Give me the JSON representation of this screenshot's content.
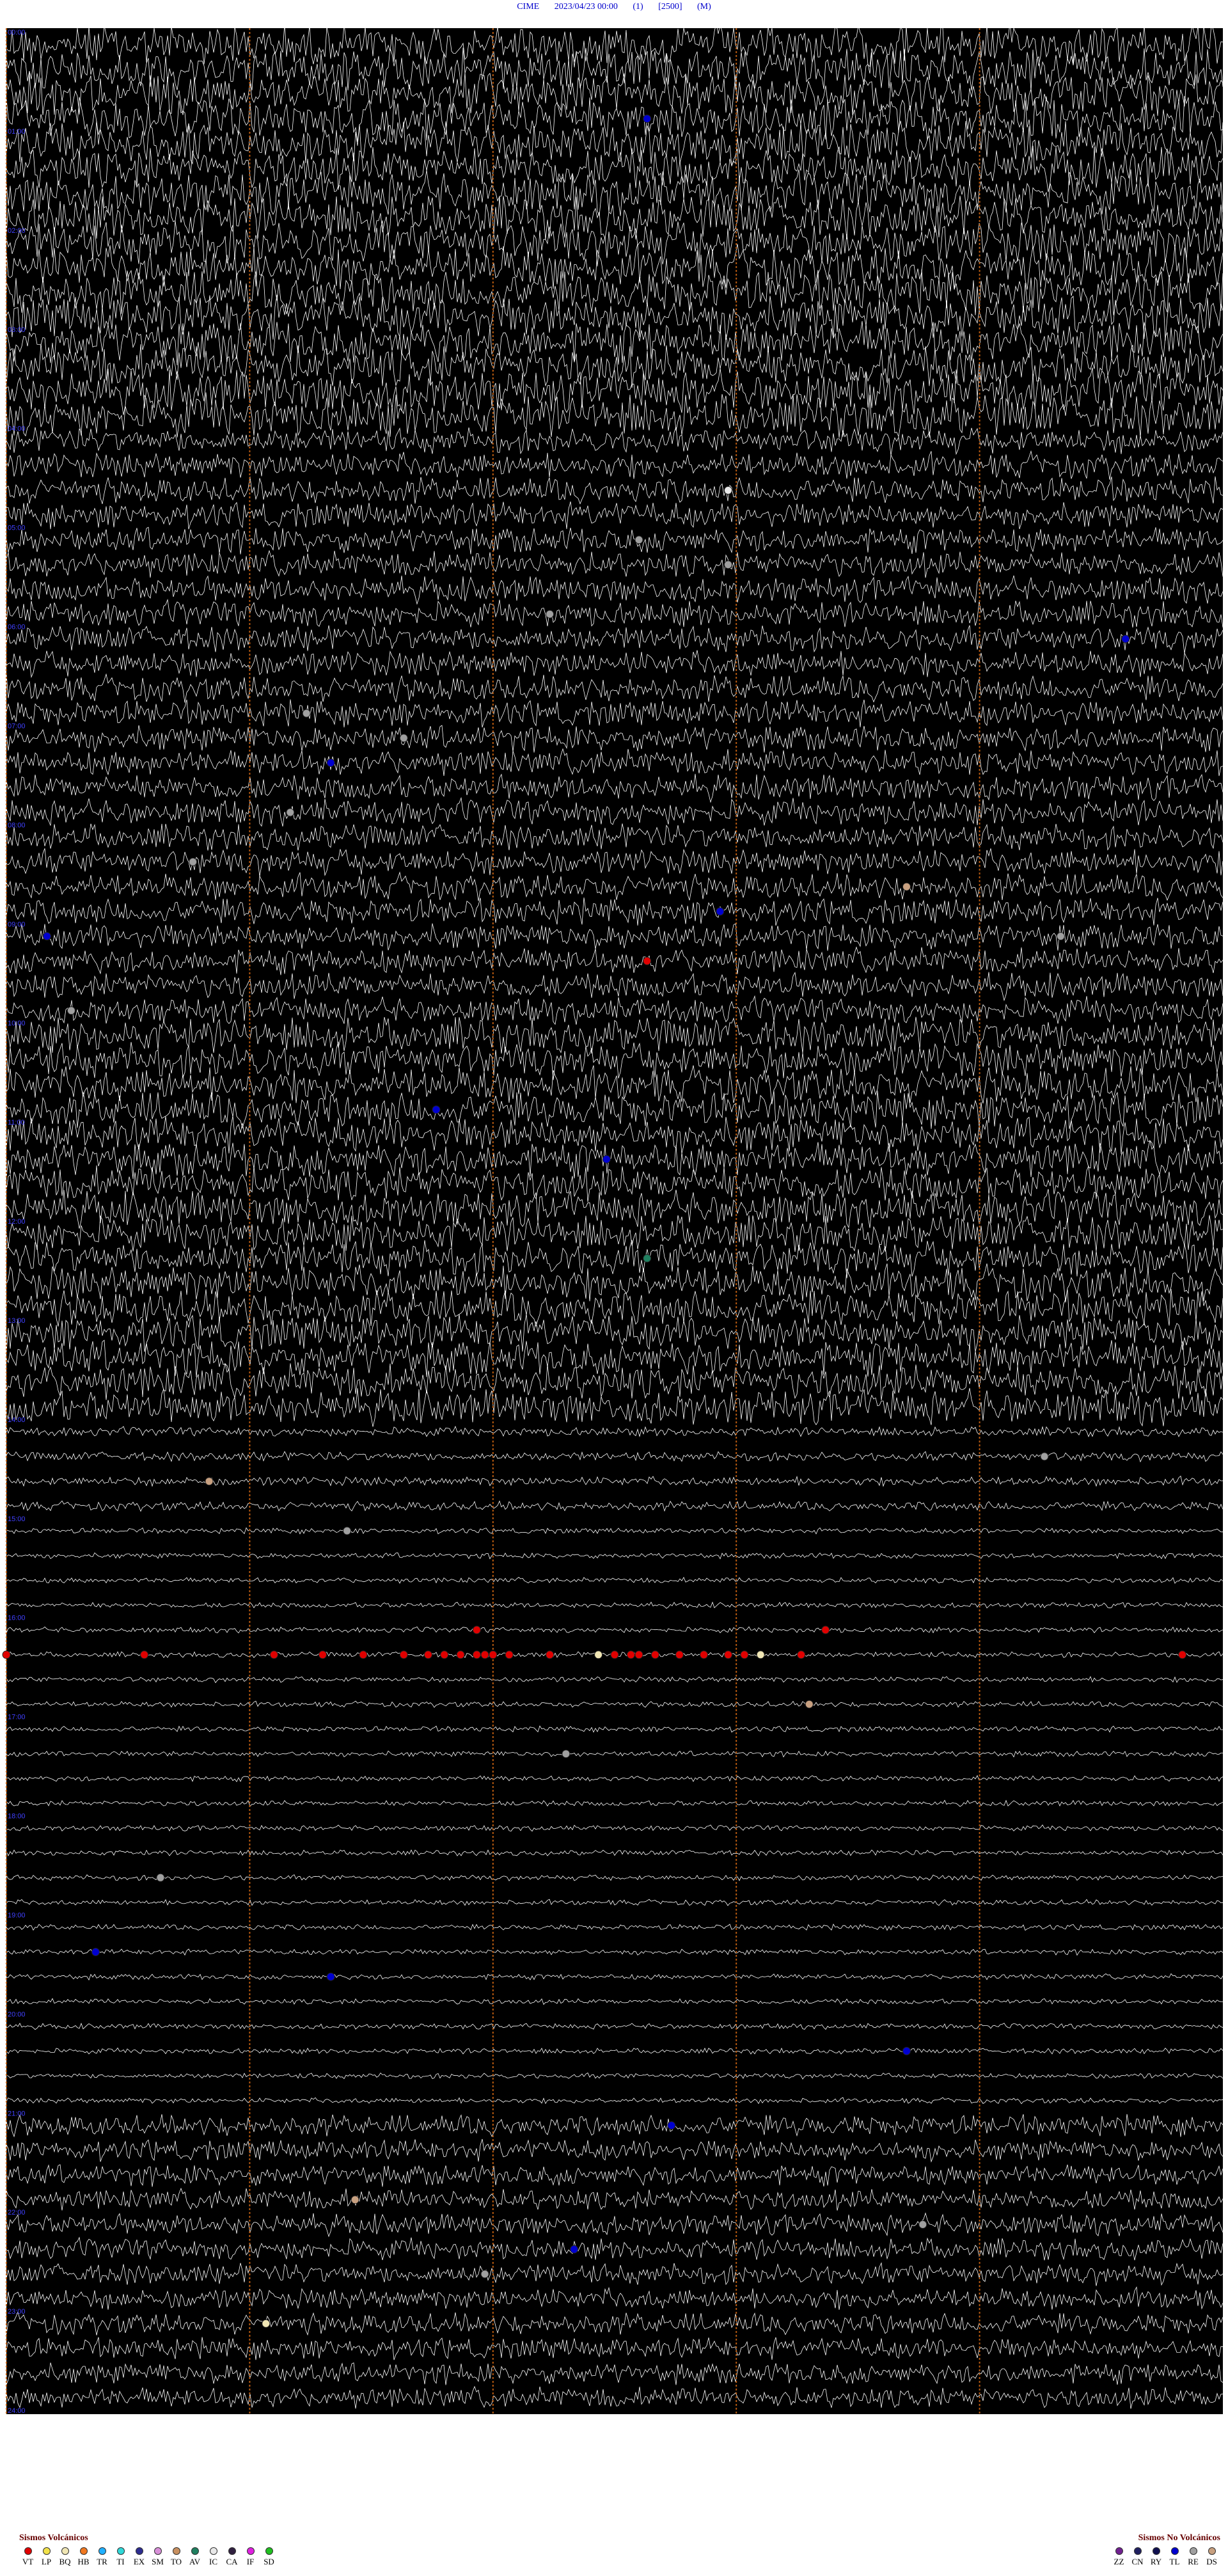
{
  "header": {
    "station": "CIME",
    "datetime": "2023/04/23 00:00",
    "component": "(1)",
    "scale": "[2500]",
    "mode": "(M)"
  },
  "chart_data": {
    "type": "scatter",
    "title": "CIME 2023/04/23 00:00 (1) [2500] (M)",
    "time_labels": [
      "00:00",
      "01:00",
      "02:00",
      "03:00",
      "04:00",
      "05:00",
      "06:00",
      "07:00",
      "08:00",
      "09:00",
      "10:00",
      "11:00",
      "12:00",
      "13:00",
      "14:00",
      "15:00",
      "16:00",
      "17:00",
      "18:00",
      "19:00",
      "20:00",
      "21:00",
      "22:00",
      "23:00",
      "24:00"
    ],
    "trace_rows": 96,
    "minutes_per_row": 15,
    "x_range_minutes": [
      0,
      15
    ],
    "minute_markers": [
      0,
      3,
      6,
      9,
      12
    ],
    "colors": {
      "VT": "#e00000",
      "LP": "#f2e24a",
      "BQ": "#f0e6b4",
      "HB": "#f07820",
      "TR": "#20b0ff",
      "TI": "#30d8d8",
      "EX": "#2c2c90",
      "SM": "#d890d8",
      "TO": "#c89060",
      "AV": "#208060",
      "IC": "#e8e8e8",
      "CA": "#302040",
      "IF": "#e020e0",
      "SD": "#20c020",
      "ZZ": "#702090",
      "CN": "#202060",
      "RY": "#101050",
      "TL": "#0000d0",
      "RE": "#a0a0a0",
      "DS": "#c8a080"
    },
    "events": [
      {
        "row": 3,
        "minute": 7.9,
        "type": "TL"
      },
      {
        "row": 18,
        "minute": 8.9,
        "type": "IC"
      },
      {
        "row": 20,
        "minute": 7.8,
        "type": "RE"
      },
      {
        "row": 21,
        "minute": 8.9,
        "type": "RE"
      },
      {
        "row": 23,
        "minute": 6.7,
        "type": "RE"
      },
      {
        "row": 24,
        "minute": 13.8,
        "type": "TL"
      },
      {
        "row": 27,
        "minute": 3.7,
        "type": "RE"
      },
      {
        "row": 28,
        "minute": 4.9,
        "type": "RE"
      },
      {
        "row": 29,
        "minute": 4.0,
        "type": "TL"
      },
      {
        "row": 31,
        "minute": 3.5,
        "type": "RE"
      },
      {
        "row": 33,
        "minute": 2.3,
        "type": "RE"
      },
      {
        "row": 34,
        "minute": 11.1,
        "type": "DS"
      },
      {
        "row": 35,
        "minute": 8.8,
        "type": "TL"
      },
      {
        "row": 36,
        "minute": 13.0,
        "type": "RE"
      },
      {
        "row": 36,
        "minute": 0.5,
        "type": "TL"
      },
      {
        "row": 37,
        "minute": 7.9,
        "type": "VT"
      },
      {
        "row": 39,
        "minute": 0.8,
        "type": "RE"
      },
      {
        "row": 43,
        "minute": 5.3,
        "type": "TL"
      },
      {
        "row": 45,
        "minute": 7.4,
        "type": "TL"
      },
      {
        "row": 49,
        "minute": 7.9,
        "type": "AV"
      },
      {
        "row": 57,
        "minute": 12.8,
        "type": "RE"
      },
      {
        "row": 58,
        "minute": 2.5,
        "type": "DS"
      },
      {
        "row": 60,
        "minute": 4.2,
        "type": "RE"
      },
      {
        "row": 65,
        "minute": 0.0,
        "type": "VT"
      },
      {
        "row": 65,
        "minute": 1.7,
        "type": "VT"
      },
      {
        "row": 65,
        "minute": 3.3,
        "type": "VT"
      },
      {
        "row": 65,
        "minute": 3.9,
        "type": "VT"
      },
      {
        "row": 65,
        "minute": 4.4,
        "type": "VT"
      },
      {
        "row": 65,
        "minute": 4.9,
        "type": "VT"
      },
      {
        "row": 65,
        "minute": 5.2,
        "type": "VT"
      },
      {
        "row": 65,
        "minute": 5.4,
        "type": "VT"
      },
      {
        "row": 65,
        "minute": 5.6,
        "type": "VT"
      },
      {
        "row": 65,
        "minute": 5.8,
        "type": "VT"
      },
      {
        "row": 65,
        "minute": 5.9,
        "type": "VT"
      },
      {
        "row": 65,
        "minute": 6.0,
        "type": "VT"
      },
      {
        "row": 65,
        "minute": 6.2,
        "type": "VT"
      },
      {
        "row": 65,
        "minute": 6.7,
        "type": "VT"
      },
      {
        "row": 65,
        "minute": 7.3,
        "type": "BQ"
      },
      {
        "row": 65,
        "minute": 7.5,
        "type": "VT"
      },
      {
        "row": 65,
        "minute": 7.7,
        "type": "VT"
      },
      {
        "row": 65,
        "minute": 7.8,
        "type": "VT"
      },
      {
        "row": 65,
        "minute": 8.0,
        "type": "VT"
      },
      {
        "row": 65,
        "minute": 8.3,
        "type": "VT"
      },
      {
        "row": 65,
        "minute": 8.6,
        "type": "VT"
      },
      {
        "row": 65,
        "minute": 8.9,
        "type": "VT"
      },
      {
        "row": 65,
        "minute": 9.1,
        "type": "VT"
      },
      {
        "row": 65,
        "minute": 9.3,
        "type": "BQ"
      },
      {
        "row": 65,
        "minute": 9.8,
        "type": "VT"
      },
      {
        "row": 65,
        "minute": 14.5,
        "type": "VT"
      },
      {
        "row": 64,
        "minute": 5.8,
        "type": "VT"
      },
      {
        "row": 64,
        "minute": 10.1,
        "type": "VT"
      },
      {
        "row": 67,
        "minute": 9.9,
        "type": "DS"
      },
      {
        "row": 69,
        "minute": 6.9,
        "type": "RE"
      },
      {
        "row": 74,
        "minute": 1.9,
        "type": "RE"
      },
      {
        "row": 77,
        "minute": 1.1,
        "type": "TL"
      },
      {
        "row": 78,
        "minute": 4.0,
        "type": "TL"
      },
      {
        "row": 81,
        "minute": 11.1,
        "type": "TL"
      },
      {
        "row": 84,
        "minute": 8.2,
        "type": "TL"
      },
      {
        "row": 87,
        "minute": 4.3,
        "type": "DS"
      },
      {
        "row": 88,
        "minute": 11.3,
        "type": "RE"
      },
      {
        "row": 89,
        "minute": 7.0,
        "type": "TL"
      },
      {
        "row": 90,
        "minute": 5.9,
        "type": "RE"
      },
      {
        "row": 92,
        "minute": 3.2,
        "type": "BQ"
      }
    ],
    "xlabel": "",
    "ylabel": "",
    "grid": true
  },
  "legend_volcanic": {
    "title": "Sismos Volcánicos",
    "items": [
      {
        "code": "VT",
        "color": "#e00000"
      },
      {
        "code": "LP",
        "color": "#f2e24a"
      },
      {
        "code": "BQ",
        "color": "#f0e6b4"
      },
      {
        "code": "HB",
        "color": "#f07820"
      },
      {
        "code": "TR",
        "color": "#20b0ff"
      },
      {
        "code": "TI",
        "color": "#30d8d8"
      },
      {
        "code": "EX",
        "color": "#2c2c90"
      },
      {
        "code": "SM",
        "color": "#d890d8"
      },
      {
        "code": "TO",
        "color": "#c89060"
      },
      {
        "code": "AV",
        "color": "#208060"
      },
      {
        "code": "IC",
        "color": "#e8e8e8"
      },
      {
        "code": "CA",
        "color": "#302040"
      },
      {
        "code": "IF",
        "color": "#e020e0"
      },
      {
        "code": "SD",
        "color": "#20c020"
      }
    ]
  },
  "legend_nonvolcanic": {
    "title": "Sismos No Volcánicos",
    "items": [
      {
        "code": "ZZ",
        "color": "#702090"
      },
      {
        "code": "CN",
        "color": "#202060"
      },
      {
        "code": "RY",
        "color": "#101050"
      },
      {
        "code": "TL",
        "color": "#0000d0"
      },
      {
        "code": "RE",
        "color": "#a0a0a0"
      },
      {
        "code": "DS",
        "color": "#c8a080"
      }
    ]
  }
}
